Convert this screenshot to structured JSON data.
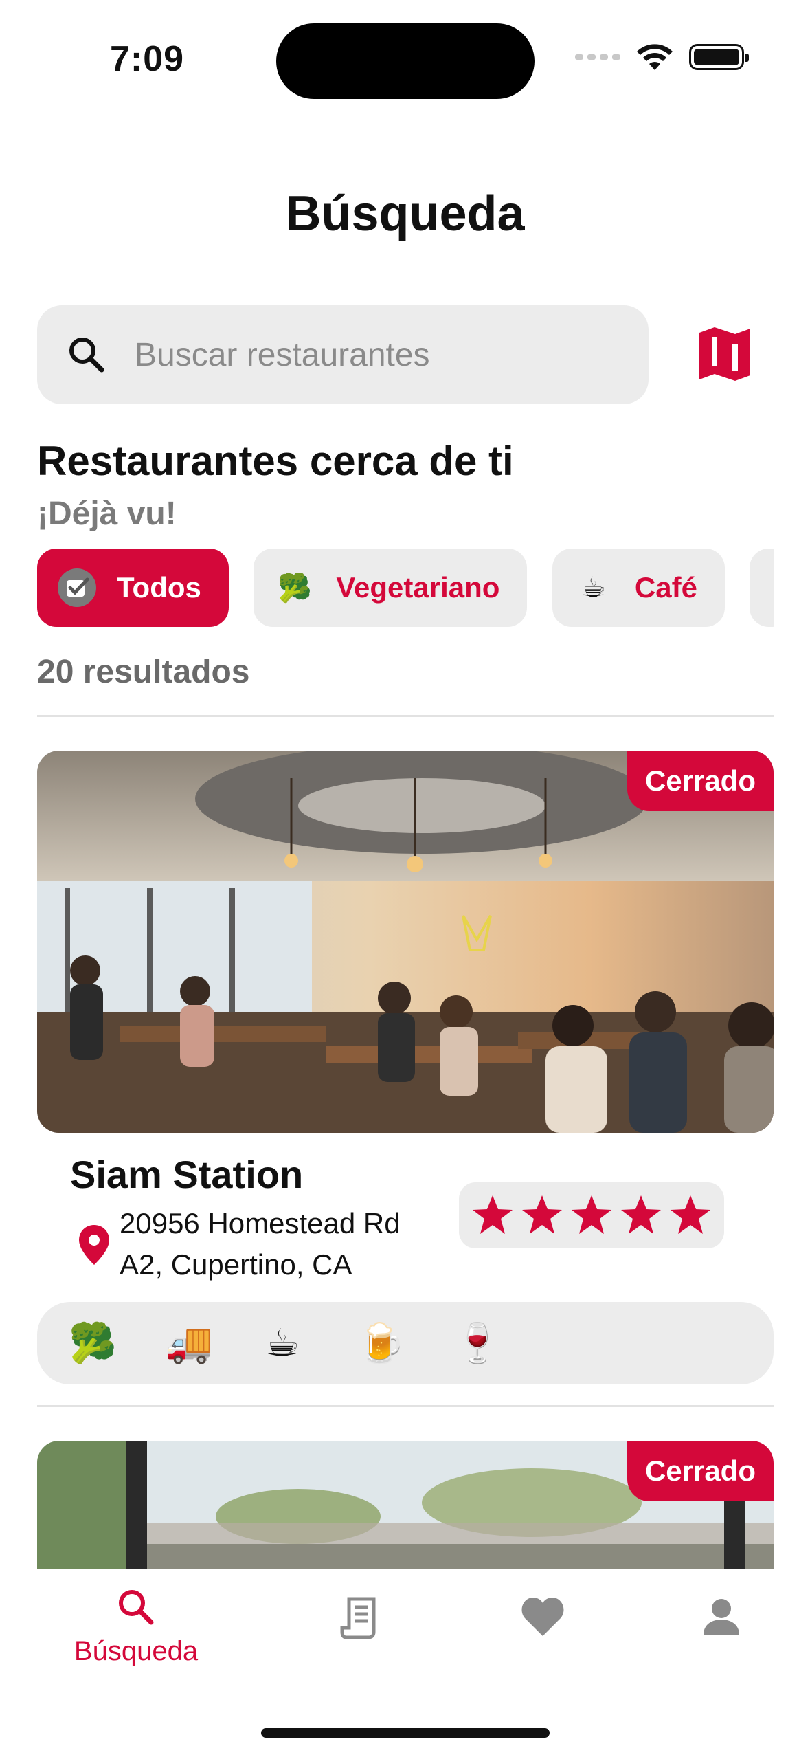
{
  "status_bar": {
    "time": "7:09"
  },
  "header": {
    "title": "Búsqueda"
  },
  "search": {
    "placeholder": "Buscar restaurantes",
    "value": ""
  },
  "section": {
    "title": "Restaurantes cerca de ti",
    "subtitle": "¡Déjà vu!"
  },
  "filters": [
    {
      "label": "Todos",
      "icon": "check-icon",
      "active": true
    },
    {
      "label": "Vegetariano",
      "emoji": "🥦",
      "active": false
    },
    {
      "label": "Café",
      "emoji": "☕",
      "active": false
    }
  ],
  "results": {
    "count_label": "20 resultados"
  },
  "restaurants": [
    {
      "name": "Siam Station",
      "address": "20956 Homestead Rd A2, Cupertino, CA",
      "status": "Cerrado",
      "rating": 5,
      "amenities": [
        "🥦",
        "🚚",
        "☕",
        "🍺",
        "🍷"
      ]
    },
    {
      "status": "Cerrado"
    }
  ],
  "tab_bar": {
    "items": [
      {
        "label": "Búsqueda",
        "icon": "search-icon",
        "active": true
      },
      {
        "label": "",
        "icon": "receipt-icon",
        "active": false
      },
      {
        "label": "",
        "icon": "heart-icon",
        "active": false
      },
      {
        "label": "",
        "icon": "profile-icon",
        "active": false
      }
    ]
  },
  "colors": {
    "accent": "#d4083a",
    "chip_bg": "#ececec",
    "muted_text": "#7a7a7a"
  }
}
